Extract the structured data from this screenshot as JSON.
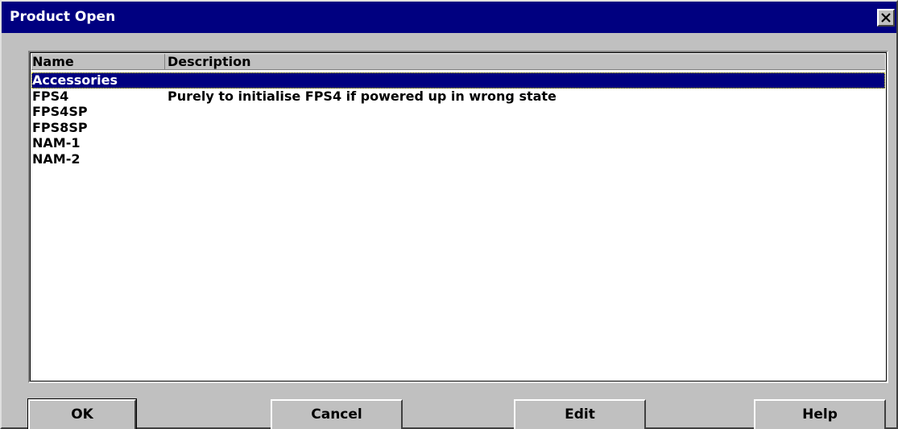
{
  "window": {
    "title": "Product Open"
  },
  "list": {
    "columns": {
      "name": "Name",
      "description": "Description"
    },
    "rows": [
      {
        "name": "Accessories",
        "description": "",
        "selected": true
      },
      {
        "name": "FPS4",
        "description": "Purely to initialise FPS4 if powered up in wrong state",
        "selected": false
      },
      {
        "name": "FPS4SP",
        "description": "",
        "selected": false
      },
      {
        "name": "FPS8SP",
        "description": "",
        "selected": false
      },
      {
        "name": "NAM-1",
        "description": "",
        "selected": false
      },
      {
        "name": "NAM-2",
        "description": "",
        "selected": false
      }
    ]
  },
  "buttons": {
    "ok": "OK",
    "cancel": "Cancel",
    "edit": "Edit",
    "help": "Help"
  },
  "icons": {
    "close": "close-icon"
  },
  "colors": {
    "titlebar": "#000080",
    "selection": "#000080",
    "face": "#c0c0c0"
  }
}
